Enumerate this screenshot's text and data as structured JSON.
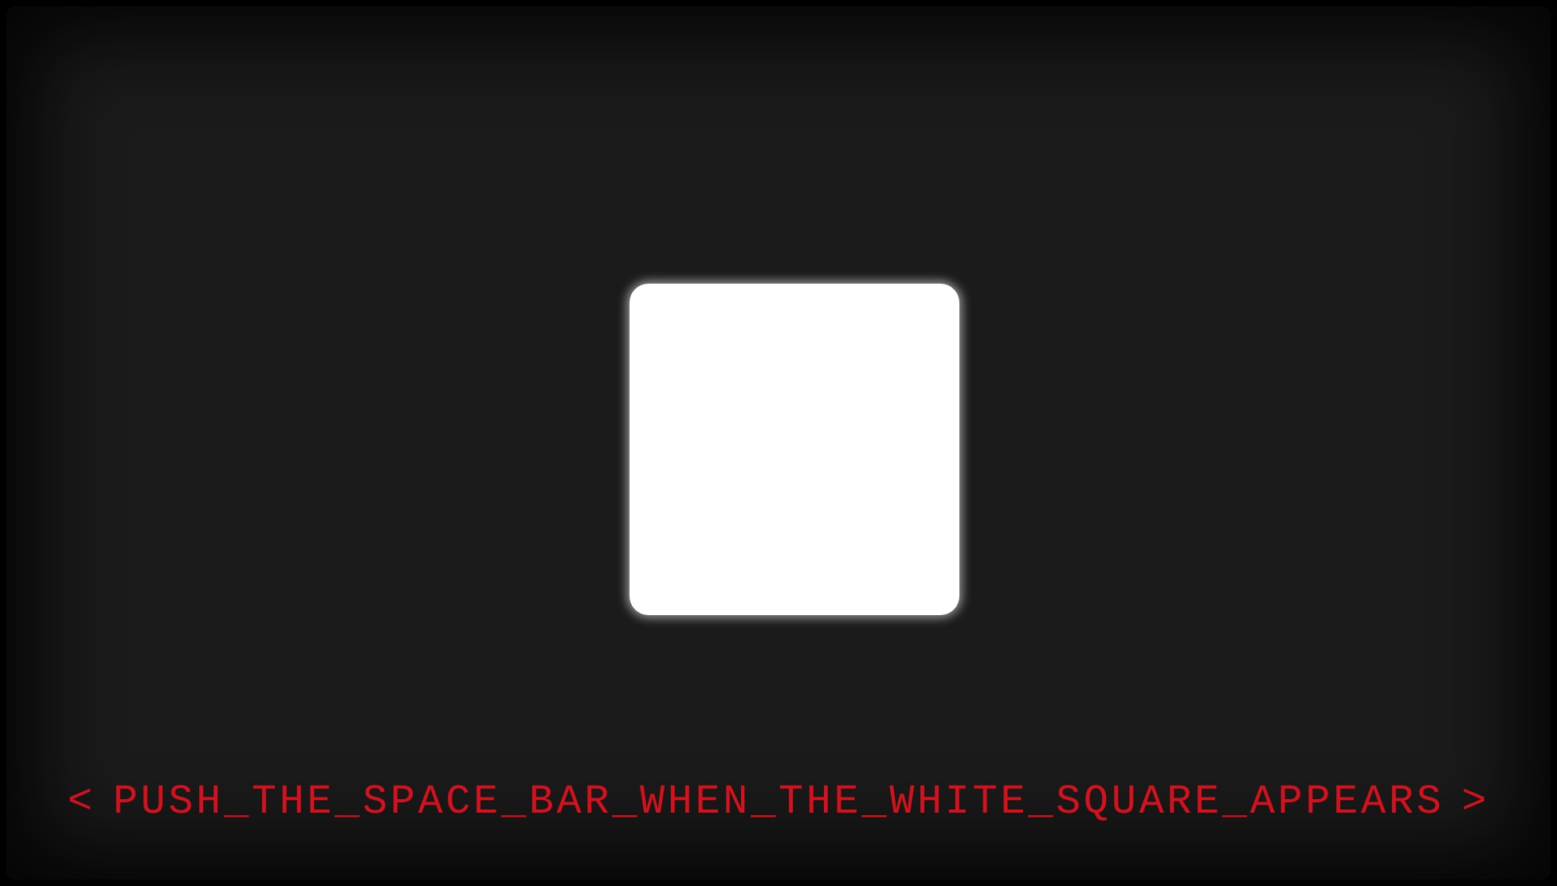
{
  "stimulus": {
    "visible": true
  },
  "prompt": {
    "left_marker": "<",
    "text": "PUSH_THE_SPACE_BAR_WHEN_THE_WHITE_SQUARE_APPEARS",
    "right_marker": ">"
  }
}
